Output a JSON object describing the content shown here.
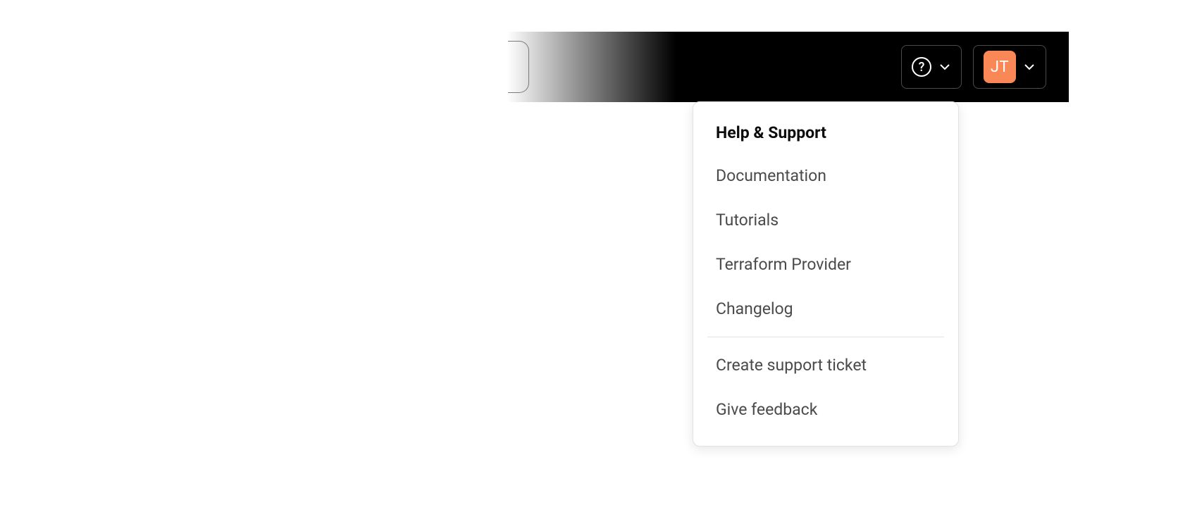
{
  "header": {
    "avatar_initials": "JT"
  },
  "help_menu": {
    "title": "Help & Support",
    "items_group1": [
      "Documentation",
      "Tutorials",
      "Terraform Provider",
      "Changelog"
    ],
    "items_group2": [
      "Create support ticket",
      "Give feedback"
    ]
  }
}
